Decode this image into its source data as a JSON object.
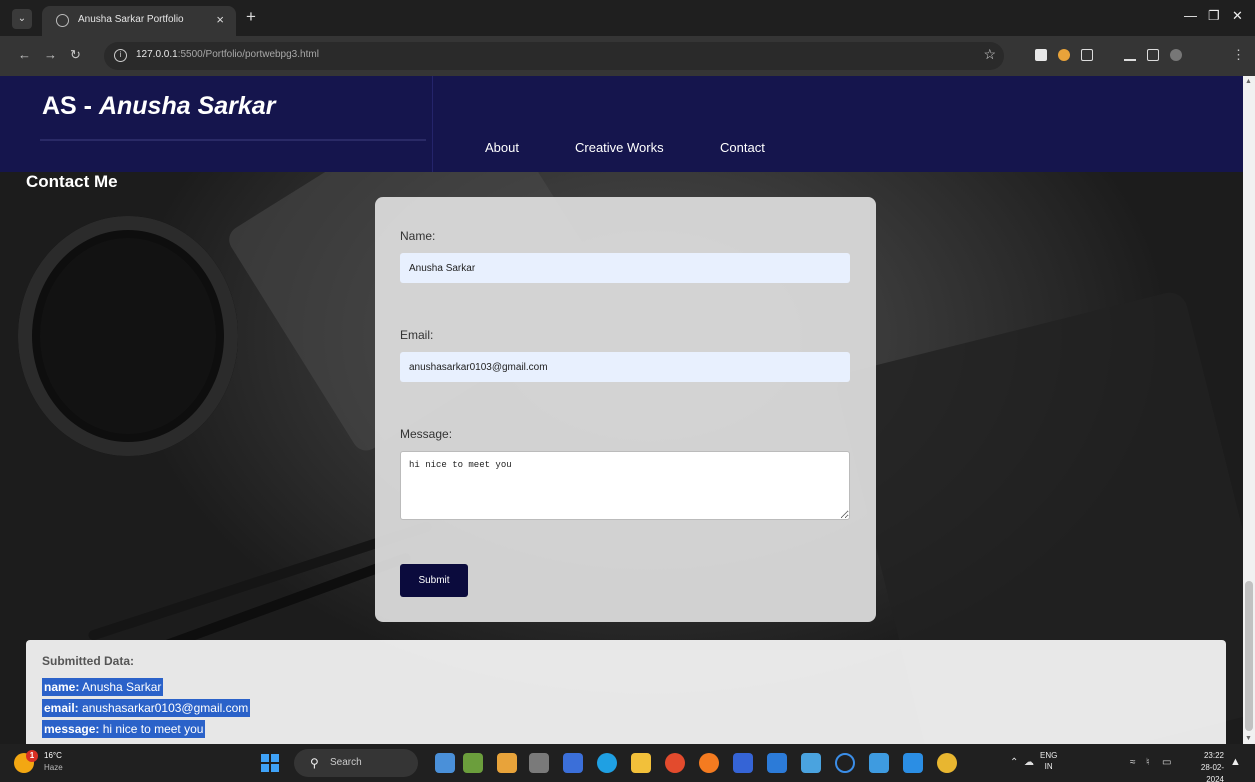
{
  "browser": {
    "tab_title": "Anusha Sarkar Portfolio",
    "url_host": "127.0.0.1",
    "url_path": ":5500/Portfolio/portwebpg3.html"
  },
  "site": {
    "brand_prefix": "AS - ",
    "brand_name": "Anusha Sarkar",
    "nav": [
      "About",
      "Creative Works",
      "Contact"
    ],
    "section_title": "Contact Me"
  },
  "form": {
    "name_label": "Name:",
    "name_value": "Anusha Sarkar",
    "email_label": "Email:",
    "email_value": "anushasarkar0103@gmail.com",
    "message_label": "Message:",
    "message_value": "hi nice to meet you",
    "submit_label": "Submit"
  },
  "submitted": {
    "title": "Submitted Data:",
    "rows": [
      {
        "key": "name:",
        "value": "Anusha Sarkar"
      },
      {
        "key": "email:",
        "value": "anushasarkar0103@gmail.com"
      },
      {
        "key": "message:",
        "value": "hi nice to meet you"
      }
    ]
  },
  "taskbar": {
    "weather_temp": "16°C",
    "weather_cond": "Haze",
    "weather_badge": "1",
    "search_placeholder": "Search",
    "lang_top": "ENG",
    "lang_bottom": "IN",
    "time": "23:22",
    "date": "28-02-2024"
  },
  "colors": {
    "header_bg": "#15154d",
    "submit_bg": "#0b0b3d",
    "selection": "#2b62c9",
    "input_autofill": "#e8f0fe"
  }
}
